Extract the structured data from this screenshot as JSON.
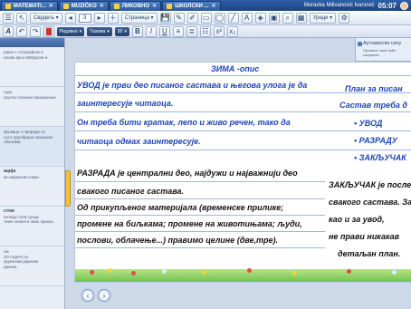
{
  "tabs": [
    {
      "label": "MATEMATI..."
    },
    {
      "label": "MUZIČKO"
    },
    {
      "label": "ЛИКОВНО"
    },
    {
      "label": "ШКОЛСКИ ..."
    }
  ],
  "status": {
    "user": "Moravka Milivanović Ivanović",
    "clock": "05:07"
  },
  "toolbar1": {
    "mode_select": "Сврдељ",
    "page_number": "3",
    "page_label": "Страница",
    "edit_label": "Уреди"
  },
  "toolbar2": {
    "style_select": "Редовно",
    "font_select": "Тахома",
    "font_size": "30"
  },
  "sidebar": {
    "items": [
      {
        "num": "",
        "title": "",
        "text": "рање с тпографске и\nалова кроз Мађарске и"
      },
      {
        "num": "",
        "title": "",
        "text": "годе\nскусли плански приказзање."
      },
      {
        "num": "",
        "title": "",
        "text": "кружице о приреди са\nосто пдеобрани описание\nобалама."
      },
      {
        "num": "",
        "title": "ација",
        "text": "мо мерилом слике."
      },
      {
        "num": "",
        "title": "стем",
        "text": "ентаци тела сунца\nтеме планети ових приказ."
      },
      {
        "num": "",
        "title": "",
        "text": "ом\n3О годите са\nпрувилим јединим\nдањем."
      }
    ]
  },
  "autosave": {
    "title": "Аутоматски сачу",
    "subtitle": "Промене ових публ\nсачување"
  },
  "slide": {
    "title": "ЗИМА -опис",
    "intro_lines": [
      "УВОД је први део писаног састава и његова улога је да",
      "заинтересује читаоца.",
      "Он треба бити кратак, лепо и живо речен, тако да",
      "читаоца одмах заинтересује."
    ],
    "plan_header": "План за писан",
    "plan_sub": "Састав треба д",
    "plan_items": [
      "УВОД",
      "РАЗРАДУ",
      "ЗАКЉУЧАК"
    ],
    "body_lines": [
      "РАЗРАДА је централни део, најдужи и најважнији део",
      "свакого писаног састава.",
      "Од прикупљеног материјала (временске прилике;",
      "промене на биљкама; промене на животињама; људи,",
      "послови, облачење...) правимо целине (две,тре)."
    ],
    "conclusion_lines": [
      "ЗАКЉУЧАК је последн",
      "свакого састава. За н",
      "као и за увод,",
      "не прави никакав",
      "детаљан план."
    ]
  }
}
